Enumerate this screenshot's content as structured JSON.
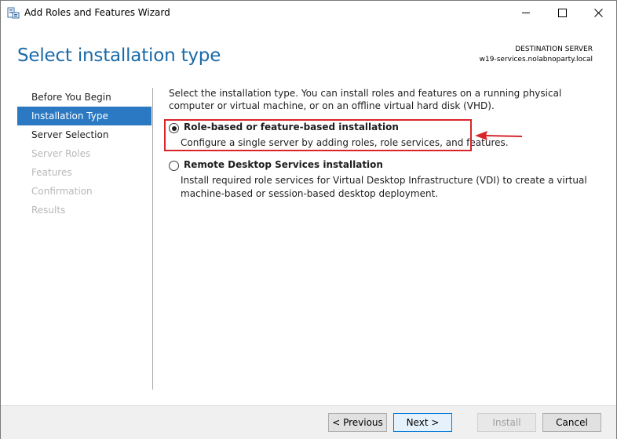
{
  "window": {
    "title": "Add Roles and Features Wizard",
    "icons": {
      "app": "server-manager-icon",
      "minimize": "minimize-icon",
      "maximize": "maximize-icon",
      "close": "close-icon"
    }
  },
  "header": {
    "page_title": "Select installation type",
    "destination_label": "DESTINATION SERVER",
    "destination_server": "w19-services.nolabnoparty.local"
  },
  "nav": {
    "items": [
      {
        "label": "Before You Begin",
        "state": "normal"
      },
      {
        "label": "Installation Type",
        "state": "active"
      },
      {
        "label": "Server Selection",
        "state": "normal"
      },
      {
        "label": "Server Roles",
        "state": "disabled"
      },
      {
        "label": "Features",
        "state": "disabled"
      },
      {
        "label": "Confirmation",
        "state": "disabled"
      },
      {
        "label": "Results",
        "state": "disabled"
      }
    ]
  },
  "content": {
    "intro": "Select the installation type. You can install roles and features on a running physical computer or virtual machine, or on an offline virtual hard disk (VHD).",
    "options": [
      {
        "title": "Role-based or feature-based installation",
        "description": "Configure a single server by adding roles, role services, and features.",
        "selected": true
      },
      {
        "title": "Remote Desktop Services installation",
        "description": "Install required role services for Virtual Desktop Infrastructure (VDI) to create a virtual machine-based or session-based desktop deployment.",
        "selected": false
      }
    ],
    "annotation_color": "#d9252a"
  },
  "footer": {
    "previous": "< Previous",
    "next": "Next >",
    "install": "Install",
    "cancel": "Cancel"
  },
  "colors": {
    "accent": "#2b79c2",
    "title_blue": "#1a6aa8",
    "disabled_text": "#b8b8b8"
  }
}
